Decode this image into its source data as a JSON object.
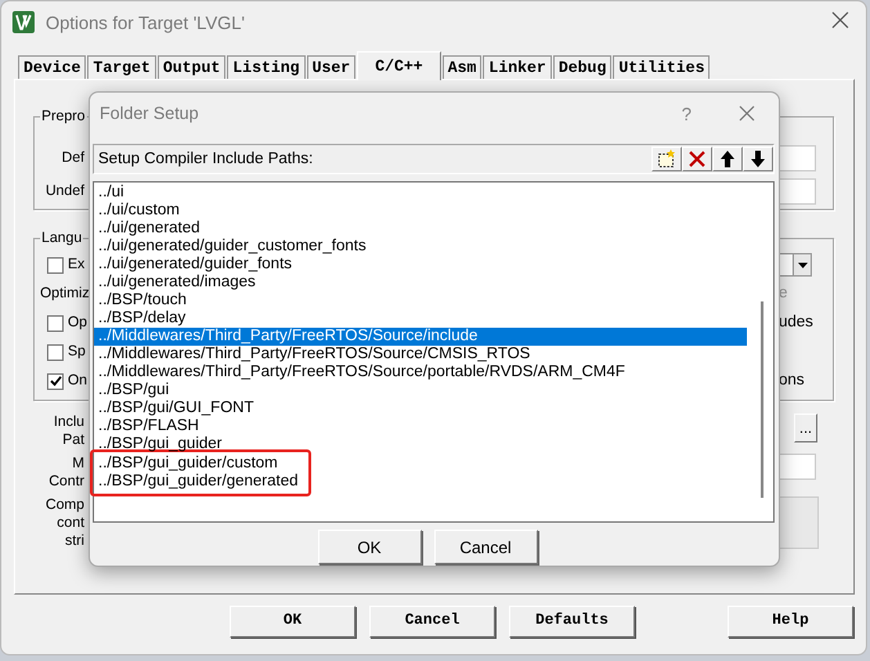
{
  "window": {
    "title": "Options for Target 'LVGL'"
  },
  "tabs": [
    {
      "label": "Device",
      "selected": false
    },
    {
      "label": "Target",
      "selected": false
    },
    {
      "label": "Output",
      "selected": false
    },
    {
      "label": "Listing",
      "selected": false
    },
    {
      "label": "User",
      "selected": false
    },
    {
      "label": "C/C++",
      "selected": true
    },
    {
      "label": "Asm",
      "selected": false
    },
    {
      "label": "Linker",
      "selected": false
    },
    {
      "label": "Debug",
      "selected": false
    },
    {
      "label": "Utilities",
      "selected": false
    }
  ],
  "preprocessor_group": {
    "title": "Prepro",
    "rows": [
      {
        "label": "Def"
      },
      {
        "label": "Undef"
      }
    ]
  },
  "language_group": {
    "title": "Langu",
    "rows": [
      {
        "kind": "checkbox",
        "label": "Ex",
        "checked": false,
        "right": {
          "kind": "dropdown"
        }
      },
      {
        "kind": "label",
        "label": "Optimiz",
        "right": {
          "kind": "disabled-text",
          "text": "e"
        }
      },
      {
        "kind": "checkbox",
        "label": "Op",
        "checked": false,
        "right": {
          "kind": "text",
          "text": "udes"
        }
      },
      {
        "kind": "checkbox",
        "label": "Sp",
        "checked": false
      },
      {
        "kind": "checkbox",
        "label": "On",
        "checked": true,
        "right": {
          "kind": "text",
          "text": "ons"
        }
      }
    ]
  },
  "lower_rows": [
    {
      "lines": [
        "Inclu",
        "Pat"
      ],
      "right": {
        "kind": "button",
        "text": "..."
      }
    },
    {
      "lines": [
        "M",
        "Contr"
      ],
      "right": {
        "kind": "field"
      }
    },
    {
      "lines": [
        "Comp",
        "cont",
        "stri"
      ],
      "right": {
        "kind": "box"
      }
    }
  ],
  "buttons": [
    "OK",
    "Cancel",
    "Defaults",
    "Help"
  ],
  "dialog": {
    "title": "Folder Setup",
    "help": "?",
    "header": "Setup Compiler Include Paths:",
    "toolbar": [
      {
        "kind": "new"
      },
      {
        "kind": "delete"
      },
      {
        "kind": "up"
      },
      {
        "kind": "down"
      }
    ],
    "paths": [
      {
        "text": "../ui",
        "selected": false,
        "highlighted": false
      },
      {
        "text": "../ui/custom",
        "selected": false,
        "highlighted": false
      },
      {
        "text": "../ui/generated",
        "selected": false,
        "highlighted": false
      },
      {
        "text": "../ui/generated/guider_customer_fonts",
        "selected": false,
        "highlighted": false
      },
      {
        "text": "../ui/generated/guider_fonts",
        "selected": false,
        "highlighted": false
      },
      {
        "text": "../ui/generated/images",
        "selected": false,
        "highlighted": false
      },
      {
        "text": "../BSP/touch",
        "selected": false,
        "highlighted": false
      },
      {
        "text": "../BSP/delay",
        "selected": false,
        "highlighted": false
      },
      {
        "text": "../Middlewares/Third_Party/FreeRTOS/Source/include",
        "selected": true,
        "highlighted": false
      },
      {
        "text": "../Middlewares/Third_Party/FreeRTOS/Source/CMSIS_RTOS",
        "selected": false,
        "highlighted": false
      },
      {
        "text": "../Middlewares/Third_Party/FreeRTOS/Source/portable/RVDS/ARM_CM4F",
        "selected": false,
        "highlighted": false
      },
      {
        "text": "../BSP/gui",
        "selected": false,
        "highlighted": false
      },
      {
        "text": "../BSP/gui/GUI_FONT",
        "selected": false,
        "highlighted": false
      },
      {
        "text": "../BSP/FLASH",
        "selected": false,
        "highlighted": false
      },
      {
        "text": "../BSP/gui_guider",
        "selected": false,
        "highlighted": false
      },
      {
        "text": "../BSP/gui_guider/custom",
        "selected": false,
        "highlighted": true
      },
      {
        "text": "../BSP/gui_guider/generated",
        "selected": false,
        "highlighted": true
      }
    ],
    "buttons": [
      "OK",
      "Cancel"
    ]
  }
}
